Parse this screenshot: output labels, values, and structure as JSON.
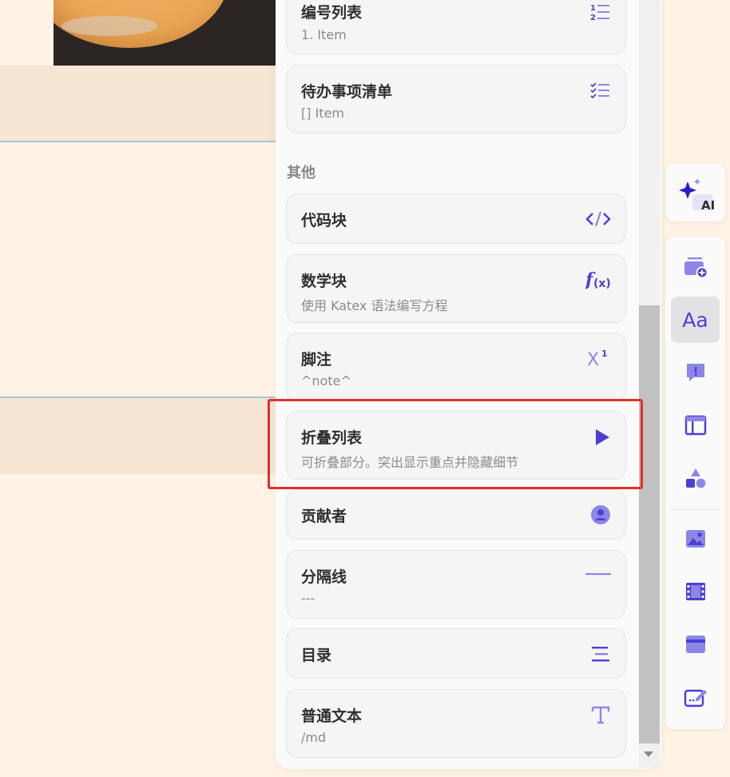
{
  "menu": {
    "items_top": [
      {
        "title": "编号列表",
        "desc": "1. Item",
        "icon": "numbered-list-icon"
      },
      {
        "title": "待办事项清单",
        "desc": "[] Item",
        "icon": "todo-list-icon"
      }
    ],
    "section_other": "其他",
    "items_other": [
      {
        "title": "代码块",
        "desc": "",
        "icon": "code-icon"
      },
      {
        "title": "数学块",
        "desc": "使用 Katex 语法编写方程",
        "icon": "math-function-icon"
      },
      {
        "title": "脚注",
        "desc": "^note^",
        "icon": "superscript-icon"
      },
      {
        "title": "折叠列表",
        "desc": "可折叠部分。突出显示重点并隐藏细节",
        "icon": "play-icon"
      },
      {
        "title": "贡献者",
        "desc": "",
        "icon": "user-circle-icon"
      },
      {
        "title": "分隔线",
        "desc": "---",
        "icon": "divider-icon"
      },
      {
        "title": "目录",
        "desc": "",
        "icon": "toc-icon"
      },
      {
        "title": "普通文本",
        "desc": "/md",
        "icon": "text-icon"
      }
    ]
  },
  "toolbar": {
    "ai_label": "AI",
    "text_style_label": "Aa",
    "tools": [
      "add-block-icon",
      "text-style-icon",
      "callout-icon",
      "layout-icon",
      "shapes-icon",
      "image-icon",
      "video-icon",
      "embed-icon",
      "edit-icon"
    ]
  },
  "colors": {
    "accent": "#4b3fd6",
    "highlight": "#e0302a",
    "background": "#fef3e4"
  }
}
